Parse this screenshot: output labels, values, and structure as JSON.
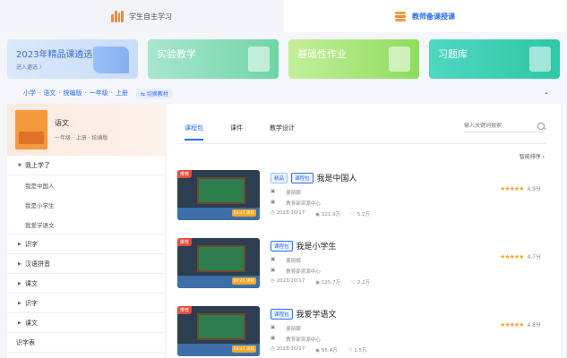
{
  "top_tabs": [
    {
      "label": "学生自主学习",
      "active": false,
      "icon": "books-icon"
    },
    {
      "label": "教师备课授课",
      "active": true,
      "icon": "stack-icon"
    }
  ],
  "banners": [
    {
      "title": "2023年精品课遴选",
      "sub": "进入遴选 〉",
      "icon": "book-open-icon"
    },
    {
      "title": "实验教学",
      "icon": "experiment-icon"
    },
    {
      "title": "基础性作业",
      "icon": "clipboard-icon"
    },
    {
      "title": "习题库",
      "icon": "document-a-icon"
    }
  ],
  "breadcrumb": {
    "items": [
      "小学",
      "语文",
      "统编版",
      "一年级",
      "上册"
    ],
    "separator": "·",
    "switch_label": "⇆ 切换教材",
    "collapse_label": "⌄"
  },
  "sidebar": {
    "book": {
      "name": "语文",
      "meta": "一年级 · 上册 · 统编版"
    },
    "tree": [
      {
        "label": "我上学了",
        "expanded": true,
        "children": [
          "我是中国人",
          "我是小学生",
          "我爱学语文"
        ]
      },
      {
        "label": "识字",
        "expanded": false
      },
      {
        "label": "汉语拼音",
        "expanded": false
      },
      {
        "label": "课文",
        "expanded": false
      },
      {
        "label": "识字",
        "expanded": false
      },
      {
        "label": "课文",
        "expanded": false
      }
    ],
    "last_item": "识字表"
  },
  "main": {
    "tabs": [
      "课程包",
      "课件",
      "教学设计"
    ],
    "active_tab": 0,
    "search_placeholder": "输入关键词搜索",
    "sort_label": "智能排序 ›",
    "courses": [
      {
        "corner": "推荐",
        "tags": [
          "精品",
          "课程包"
        ],
        "title": "我是中国人",
        "author": "姜丽娜",
        "org": "教育部资源中心",
        "date": "2023/10/17",
        "views": "321.9万",
        "likes": "5.2万",
        "score": "4.9分",
        "duration": "08:45 课程"
      },
      {
        "corner": "推荐",
        "tags": [
          "课程包"
        ],
        "title": "我是小学生",
        "author": "姜丽娜",
        "org": "教育部资源中心",
        "date": "2023/10/17",
        "views": "125.7万",
        "likes": "2.2万",
        "score": "4.7分",
        "duration": "08:45 课程"
      },
      {
        "corner": "推荐",
        "tags": [
          "课程包"
        ],
        "title": "我爱学语文",
        "author": "姜丽娜",
        "org": "教育部资源中心",
        "date": "2023/10/17",
        "views": "85.4万",
        "likes": "1.5万",
        "score": "4.8分",
        "duration": "08:45 课程"
      }
    ]
  },
  "colors": {
    "accent": "#2d6bf4",
    "star": "#f5a623"
  }
}
